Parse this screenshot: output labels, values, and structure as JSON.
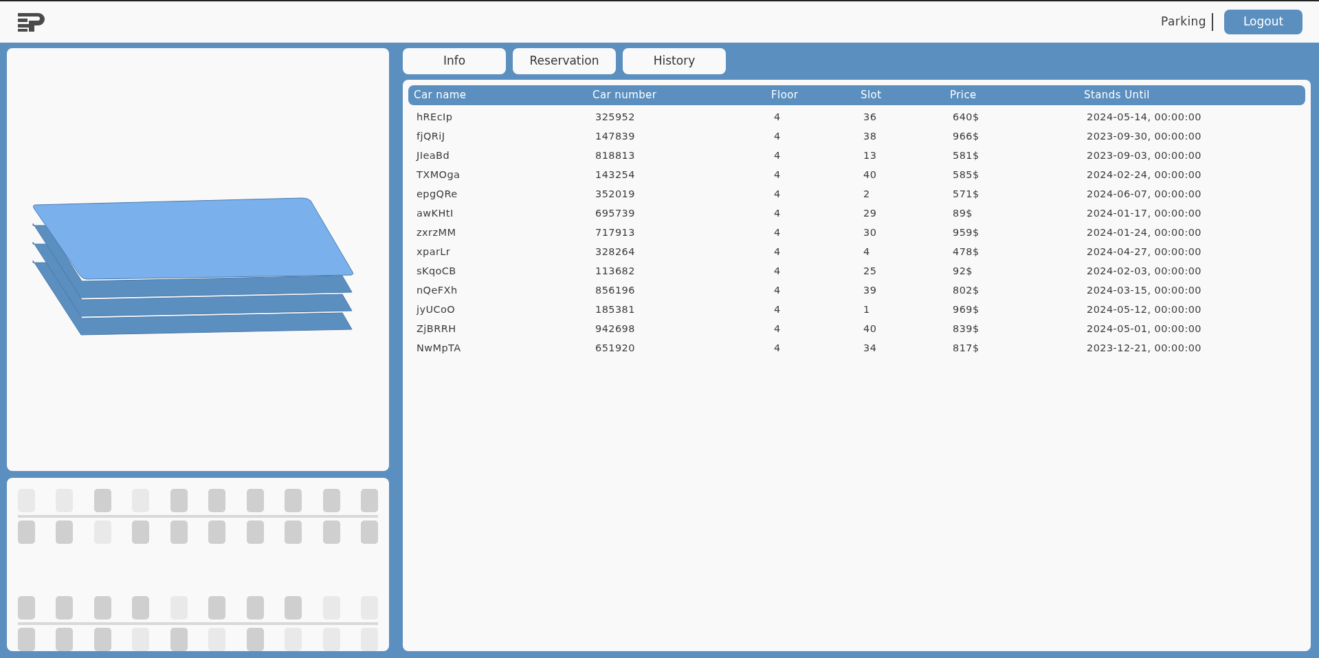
{
  "header": {
    "title": "Parking",
    "logout": "Logout"
  },
  "floors": [
    {
      "selected": true
    },
    {
      "selected": false
    },
    {
      "selected": false
    },
    {
      "selected": false
    }
  ],
  "slot_map": {
    "rows": [
      {
        "slots": [
          false,
          false,
          true,
          false,
          true,
          true,
          true,
          true,
          true,
          true
        ]
      },
      {
        "slots": [
          true,
          true,
          false,
          true,
          true,
          true,
          true,
          true,
          true,
          true
        ]
      },
      {
        "slots": [
          true,
          true,
          true,
          true,
          false,
          true,
          true,
          true,
          false,
          false
        ]
      },
      {
        "slots": [
          true,
          true,
          true,
          false,
          true,
          false,
          true,
          false,
          false,
          false
        ]
      }
    ]
  },
  "tabs": [
    {
      "label": "Info"
    },
    {
      "label": "Reservation"
    },
    {
      "label": "History"
    }
  ],
  "table": {
    "columns": [
      "Car name",
      "Car number",
      "Floor",
      "Slot",
      "Price",
      "Stands Until"
    ],
    "rows": [
      [
        "hREcIp",
        "325952",
        "4",
        "36",
        "640$",
        "2024-05-14, 00:00:00"
      ],
      [
        "fjQRiJ",
        "147839",
        "4",
        "38",
        "966$",
        "2023-09-30, 00:00:00"
      ],
      [
        "JIeaBd",
        "818813",
        "4",
        "13",
        "581$",
        "2023-09-03, 00:00:00"
      ],
      [
        "TXMOga",
        "143254",
        "4",
        "40",
        "585$",
        "2024-02-24, 00:00:00"
      ],
      [
        "epgQRe",
        "352019",
        "4",
        "2",
        "571$",
        "2024-06-07, 00:00:00"
      ],
      [
        "awKHtI",
        "695739",
        "4",
        "29",
        "89$",
        "2024-01-17, 00:00:00"
      ],
      [
        "zxrzMM",
        "717913",
        "4",
        "30",
        "959$",
        "2024-01-24, 00:00:00"
      ],
      [
        "xparLr",
        "328264",
        "4",
        "4",
        "478$",
        "2024-04-27, 00:00:00"
      ],
      [
        "sKqoCB",
        "113682",
        "4",
        "25",
        "92$",
        "2024-02-03, 00:00:00"
      ],
      [
        "nQeFXh",
        "856196",
        "4",
        "39",
        "802$",
        "2024-03-15, 00:00:00"
      ],
      [
        "jyUCoO",
        "185381",
        "4",
        "1",
        "969$",
        "2024-05-12, 00:00:00"
      ],
      [
        "ZjBRRH",
        "942698",
        "4",
        "40",
        "839$",
        "2024-05-01, 00:00:00"
      ],
      [
        "NwMpTA",
        "651920",
        "4",
        "34",
        "817$",
        "2023-12-21, 00:00:00"
      ]
    ]
  }
}
